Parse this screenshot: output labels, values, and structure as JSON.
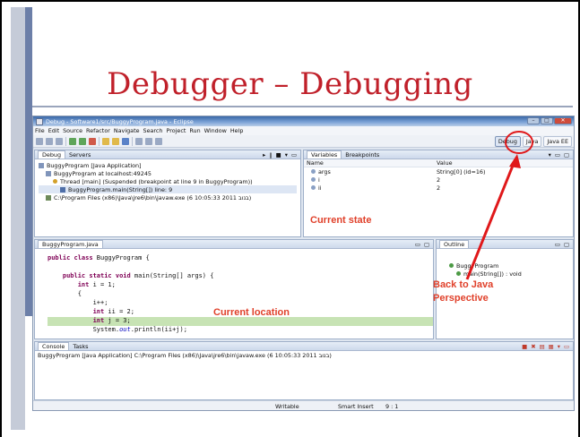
{
  "slide": {
    "title": "Debugger – Debugging"
  },
  "window": {
    "title": "Debug - Software1/src/BuggyProgram.java - Eclipse",
    "menu": [
      "File",
      "Edit",
      "Source",
      "Refactor",
      "Navigate",
      "Search",
      "Project",
      "Run",
      "Window",
      "Help"
    ],
    "perspectives": [
      "Debug",
      "Java",
      "Java EE"
    ]
  },
  "debug_view": {
    "tabs": [
      "Debug",
      "Servers"
    ],
    "tree": [
      "BuggyProgram [Java Application]",
      "BuggyProgram at localhost:49245",
      "Thread [main] (Suspended (breakpoint at line 9 in BuggyProgram))",
      "BuggyProgram.main(String[]) line: 9",
      "C:\\Program Files (x86)\\Java\\jre6\\bin\\javaw.exe (6 10:05:33 2011 בנוב)"
    ]
  },
  "variables_view": {
    "tabs": [
      "Variables",
      "Breakpoints"
    ],
    "columns": [
      "Name",
      "Value"
    ],
    "rows": [
      {
        "name": "args",
        "value": "String[0]  (id=16)"
      },
      {
        "name": "i",
        "value": "2"
      },
      {
        "name": "ii",
        "value": "2"
      }
    ]
  },
  "editor": {
    "tab": "BuggyProgram.java",
    "lines": [
      {
        "kw": "public class",
        "rest": " BuggyProgram {"
      },
      {
        "kw": "",
        "rest": ""
      },
      {
        "kw": "    public static void",
        "rest": " main(String[] args) {"
      },
      {
        "kw": "        int",
        "rest": " i = 1;"
      },
      {
        "kw": "",
        "rest": "        {"
      },
      {
        "kw": "",
        "rest": "            i++;"
      },
      {
        "kw": "            int",
        "rest": " ii = 2;"
      },
      {
        "kw": "            int",
        "rest": " j = 3;"
      },
      {
        "kw": "",
        "rest": "            System.",
        "it": "out",
        "tail": ".println(ii+j);"
      }
    ]
  },
  "outline_view": {
    "tab": "Outline",
    "items": [
      "BuggyProgram",
      "main(String[]) : void"
    ]
  },
  "console_view": {
    "tabs": [
      "Console",
      "Tasks"
    ],
    "text": "BuggyProgram [Java Application] C:\\Program Files (x86)\\Java\\jre6\\bin\\javaw.exe (6 10:05:33 2011 בנוב)"
  },
  "status": {
    "writable": "Writable",
    "insert": "Smart Insert",
    "position": "9 : 1"
  },
  "annotations": {
    "current_state": "Current state",
    "current_location": "Current location",
    "back_to_java": "Back to Java",
    "perspective": "Perspective"
  },
  "colors": {
    "title": "#c0202a",
    "annotation": "#e0402a",
    "highlight_line": "#c7e3b4"
  }
}
